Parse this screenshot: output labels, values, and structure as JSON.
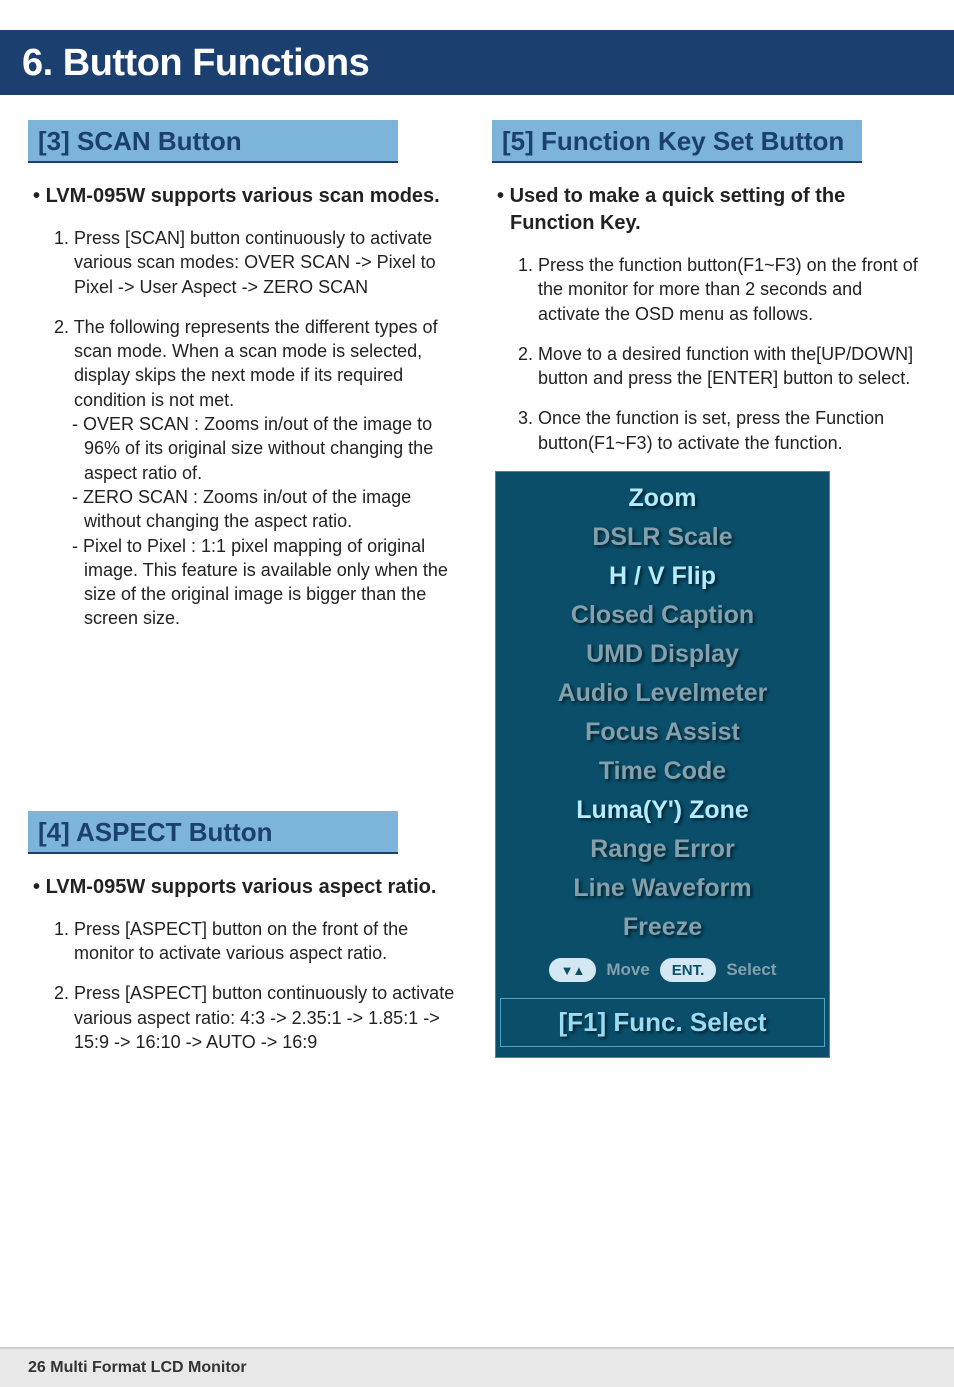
{
  "chapter": {
    "title": "6. Button Functions"
  },
  "left": {
    "sec3": {
      "header": "[3] SCAN Button",
      "bullet": "LVM-095W supports various scan modes.",
      "item1": "1. Press [SCAN] button continuously to activate various scan modes: OVER SCAN -> Pixel to Pixel -> User Aspect -> ZERO SCAN",
      "item2": "2. The following represents the different types of scan mode. When a scan mode is selected, display skips the next mode if its required condition is not met.",
      "sub1": "- OVER SCAN : Zooms in/out of the image to 96% of its original size without changing the aspect ratio of.",
      "sub2": "- ZERO SCAN : Zooms in/out of the image without changing the aspect ratio.",
      "sub3": "- Pixel to Pixel : 1:1 pixel mapping of original image. This feature is available only when the size of the original image is bigger than the screen size."
    },
    "sec4": {
      "header": "[4] ASPECT Button",
      "bullet": "LVM-095W supports various aspect ratio.",
      "item1": "1. Press [ASPECT] button on the front of the monitor to activate various aspect ratio.",
      "item2": "2. Press [ASPECT] button continuously to activate various aspect ratio: 4:3 -> 2.35:1 -> 1.85:1 -> 15:9 -> 16:10 -> AUTO -> 16:9"
    }
  },
  "right": {
    "sec5": {
      "header": "[5] Function Key Set Button",
      "bullet": "Used to make a quick setting of the Function Key.",
      "item1": "1. Press the function button(F1~F3) on the front of the monitor for more than 2 seconds and activate the OSD menu as follows.",
      "item2": "2. Move to a desired function with the[UP/DOWN] button and press the [ENTER] button to select.",
      "item3": "3. Once the function is set, press the Function button(F1~F3) to activate the function."
    }
  },
  "osd": {
    "items": [
      "Zoom",
      "DSLR Scale",
      "H / V Flip",
      "Closed Caption",
      "UMD Display",
      "Audio Levelmeter",
      "Focus Assist",
      "Time Code",
      "Luma(Y') Zone",
      "Range Error",
      "Line Waveform",
      "Freeze"
    ],
    "move": "Move",
    "ent": "ENT.",
    "select": "Select",
    "title": "[F1] Func. Select"
  },
  "footer": {
    "text": "26 Multi Format LCD Monitor"
  }
}
